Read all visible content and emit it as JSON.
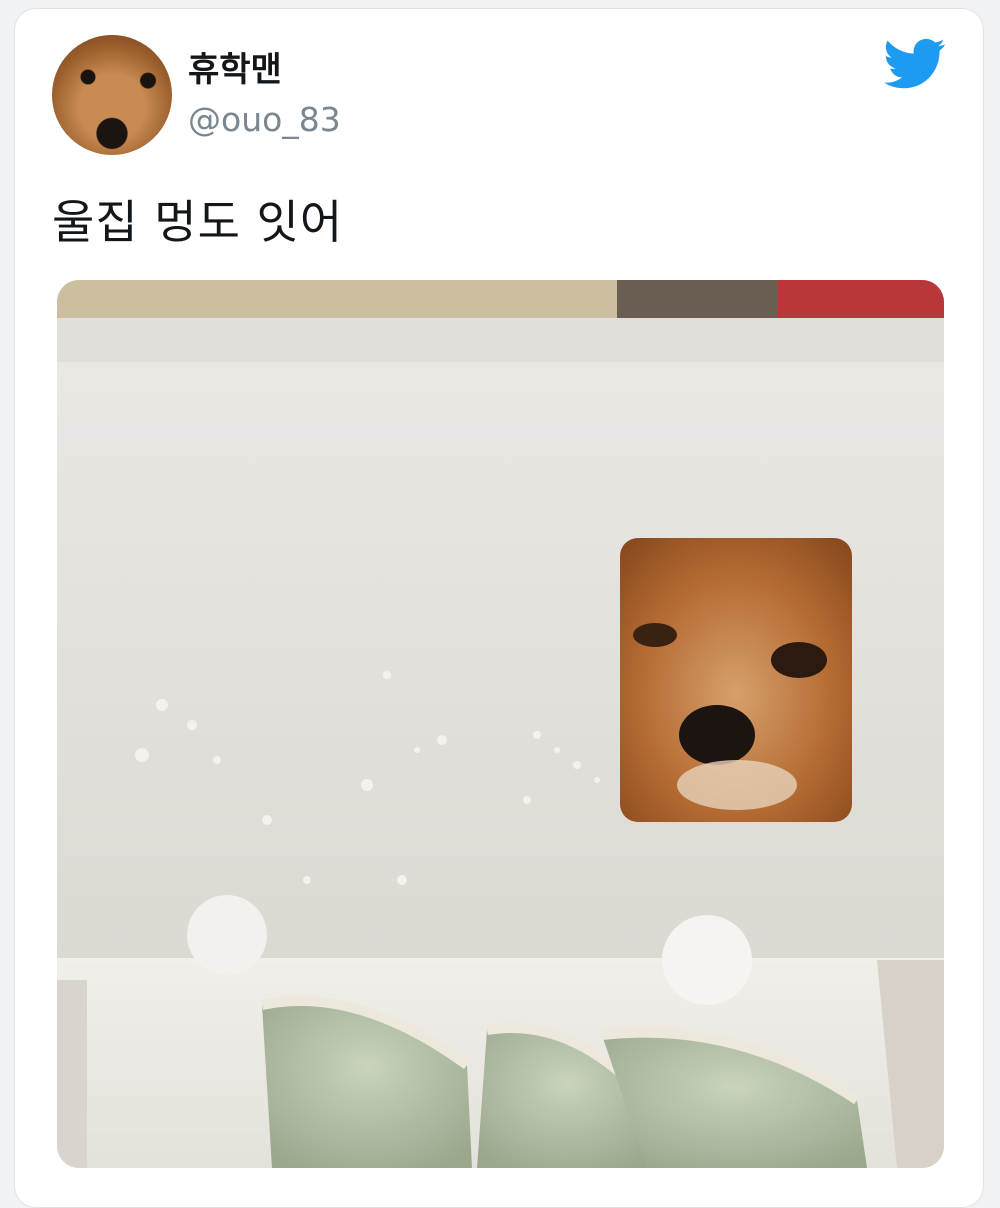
{
  "tweet": {
    "display_name": "휴학맨",
    "handle": "@ouo_83",
    "text": "울집 멍도 잇어"
  },
  "icons": {
    "avatar": "dog-avatar",
    "brand": "twitter-bird-icon"
  },
  "colors": {
    "twitter_blue": "#1d9bf0",
    "text": "#14171a",
    "handle": "#7a8690"
  }
}
